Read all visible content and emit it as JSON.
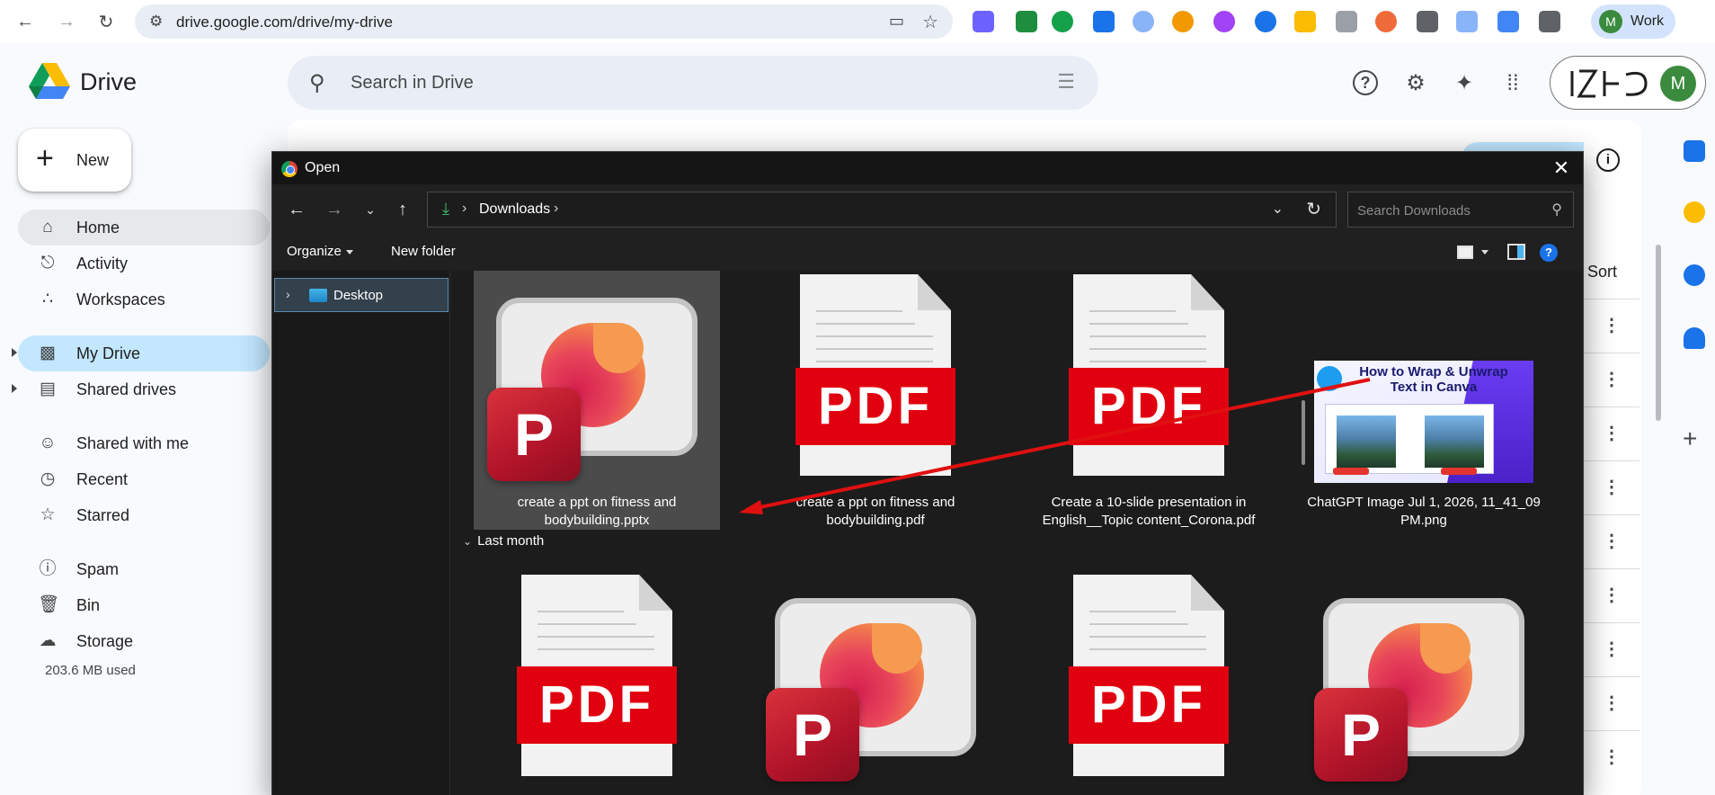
{
  "browser": {
    "url": "drive.google.com/drive/my-drive",
    "profile_initial": "M",
    "profile_label": "Work"
  },
  "drive": {
    "app_name": "Drive",
    "search_placeholder": "Search in Drive",
    "new_label": "New",
    "account_initial": "M",
    "sidebar": [
      {
        "label": "Home",
        "icon": "home-icon"
      },
      {
        "label": "Activity",
        "icon": "bell-icon"
      },
      {
        "label": "Workspaces",
        "icon": "workspaces-icon"
      },
      {
        "label": "My Drive",
        "icon": "my-drive-icon"
      },
      {
        "label": "Shared drives",
        "icon": "shared-drives-icon"
      },
      {
        "label": "Shared with me",
        "icon": "people-icon"
      },
      {
        "label": "Recent",
        "icon": "clock-icon"
      },
      {
        "label": "Starred",
        "icon": "star-icon"
      },
      {
        "label": "Spam",
        "icon": "spam-icon"
      },
      {
        "label": "Bin",
        "icon": "trash-icon"
      },
      {
        "label": "Storage",
        "icon": "cloud-icon"
      }
    ],
    "storage_used": "203.6 MB used",
    "sort_label": "Sort"
  },
  "dialog": {
    "title": "Open",
    "path_segment": "Downloads",
    "search_placeholder": "Search Downloads",
    "organize_label": "Organize",
    "new_folder_label": "New folder",
    "tree": [
      {
        "label": "Desktop"
      }
    ],
    "group_label": "Last month",
    "files": [
      {
        "name": "create a ppt on fitness and bodybuilding.pptx",
        "type": "pptx",
        "selected": true
      },
      {
        "name": "create a ppt on fitness and bodybuilding.pdf",
        "type": "pdf"
      },
      {
        "name": "Create a 10-slide presentation in English__Topic  content_Corona.pdf",
        "type": "pdf"
      },
      {
        "name": "ChatGPT Image Jul 1, 2026, 11_41_09 PM.png",
        "type": "png"
      }
    ],
    "last_month_files": [
      {
        "type": "pdf"
      },
      {
        "type": "pptx"
      },
      {
        "type": "pdf"
      },
      {
        "type": "pptx"
      }
    ],
    "pdf_label": "PDF",
    "ppt_letter": "P",
    "png_thumb_title": "How to Wrap & Unwrap Text in Canva"
  },
  "colors": {
    "accent_active": "#c2e7ff",
    "pdf_red": "#e1000f",
    "annotation_red": "#e01010"
  }
}
